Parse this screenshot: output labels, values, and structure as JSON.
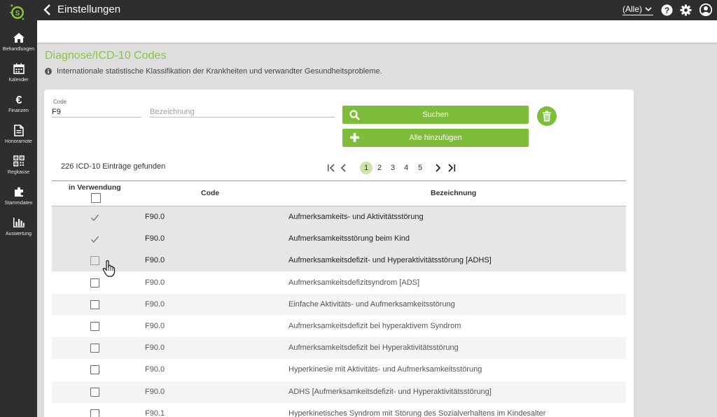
{
  "topbar": {
    "title": "Einstellungen",
    "filter_value": "(Alle)"
  },
  "sidebar": {
    "items": [
      {
        "label": "Behandlungen",
        "icon": "home-icon"
      },
      {
        "label": "Kalender",
        "icon": "calendar-icon"
      },
      {
        "label": "Finanzen",
        "icon": "euro-icon"
      },
      {
        "label": "Honorarnote",
        "icon": "document-icon"
      },
      {
        "label": "Regkasse",
        "icon": "qr-code-icon"
      },
      {
        "label": "Stammdaten",
        "icon": "puzzle-icon"
      },
      {
        "label": "Auswertung",
        "icon": "bar-chart-icon"
      }
    ]
  },
  "page": {
    "title": "Diagnose/ICD-10 Codes",
    "info": "Internationale statistische Klassifikation der Krankheiten und verwandter Gesundheitsprobleme."
  },
  "search": {
    "code_label": "Code",
    "code_value": "F9",
    "desc_placeholder": "Bezeichnung",
    "search_label": "Suchen",
    "add_all_label": "Alle hinzufügen"
  },
  "results": {
    "found_text": "226 ICD-10 Einträge gefunden",
    "pages": [
      "1",
      "2",
      "3",
      "4",
      "5"
    ],
    "active_page": "1"
  },
  "table": {
    "headers": {
      "in_use": "in Verwendung",
      "code": "Code",
      "desc": "Bezeichnung"
    },
    "rows": [
      {
        "checked": true,
        "selected": true,
        "code": "F90.0",
        "desc": "Aufmerksamkeits- und Aktivitätsstörung"
      },
      {
        "checked": true,
        "selected": true,
        "code": "F90.0",
        "desc": "Aufmerksamkeitsstörung beim Kind"
      },
      {
        "checked": false,
        "selected": true,
        "code": "F90.0",
        "desc": "Aufmerksamkeitsdefizit- und Hyperaktivitätsstörung [ADHS]"
      },
      {
        "checked": false,
        "selected": false,
        "code": "F90.0",
        "desc": "Aufmerksamkeitsdefizitsyndrom [ADS]"
      },
      {
        "checked": false,
        "selected": false,
        "code": "F90.0",
        "desc": "Einfache Aktivitäts- und Aufmerksamkeitsstörung"
      },
      {
        "checked": false,
        "selected": false,
        "code": "F90.0",
        "desc": "Aufmerksamkeitsdefizit bei hyperaktivem Syndrom"
      },
      {
        "checked": false,
        "selected": false,
        "code": "F90.0",
        "desc": "Aufmerksamkeitsdefizit bei Hyperaktivitätsstörung"
      },
      {
        "checked": false,
        "selected": false,
        "code": "F90.0",
        "desc": "Hyperkinesie mit Aktivitäts- und Aufmerksamkeitsstörung"
      },
      {
        "checked": false,
        "selected": false,
        "code": "F90.0",
        "desc": "ADHS [Aufmerksamkeitsdefizit- und Hyperaktivitätsstörung]"
      },
      {
        "checked": false,
        "selected": false,
        "code": "F90.1",
        "desc": "Hyperkinetisches Syndrom mit Störung des Sozialverhaltens im Kindesalter"
      }
    ]
  },
  "colors": {
    "accent": "#8cc63f",
    "button": "#7dbd3a",
    "dark": "#2e2e2e"
  }
}
